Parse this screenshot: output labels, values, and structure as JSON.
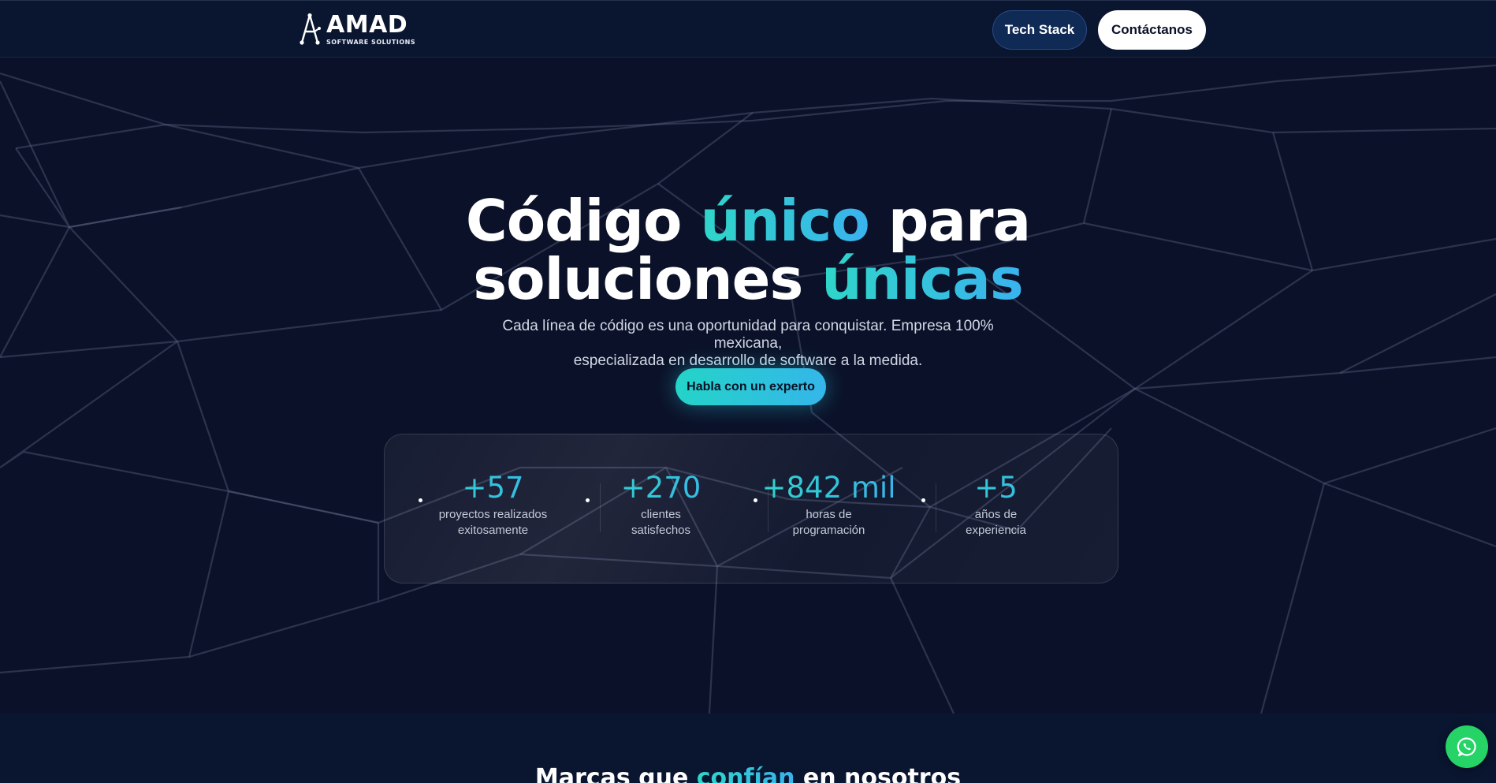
{
  "nav": {
    "logo_name": "AMAD",
    "logo_sub": "SOFTWARE SOLUTIONS",
    "tech_stack": "Tech Stack",
    "contact": "Contáctanos"
  },
  "hero": {
    "title_line1_a": "Código ",
    "title_line1_b": "único",
    "title_line1_c": " para",
    "title_line2_a": "soluciones ",
    "title_line2_b": "únicas",
    "subtitle_line1": "Cada línea de código es una oportunidad para conquistar. Empresa 100% mexicana,",
    "subtitle_line2": "especializada en desarrollo de software a la medida.",
    "cta": "Habla con un experto"
  },
  "stats": [
    {
      "value": "+57",
      "label_line1": "proyectos realizados",
      "label_line2": "exitosamente"
    },
    {
      "value": "+270",
      "label_line1": "clientes",
      "label_line2": "satisfechos"
    },
    {
      "value": "+842 mil",
      "label_line1": "horas de",
      "label_line2": "programación"
    },
    {
      "value": "+5",
      "label_line1": "años de",
      "label_line2": "experiencia"
    }
  ],
  "brands": {
    "title_a": "Marcas que ",
    "title_b": "confían",
    "title_c": " en nosotros"
  },
  "colors": {
    "background": "#0b1128",
    "nav": "#0a1530",
    "accent_start": "#2fd6c8",
    "accent_end": "#3ab2ee",
    "whatsapp": "#25d366"
  },
  "icons": {
    "logo": "amad-logo-icon",
    "whatsapp": "whatsapp-icon"
  }
}
